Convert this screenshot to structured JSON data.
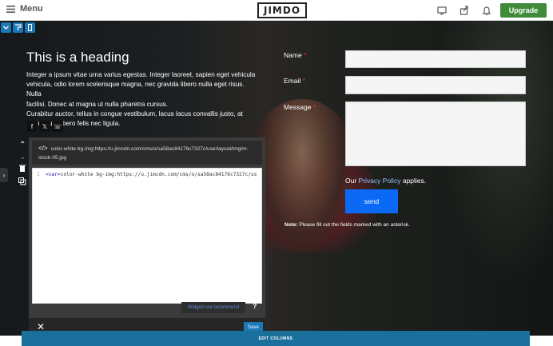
{
  "topbar": {
    "menu_label": "Menu",
    "logo": "JIMDO",
    "upgrade_label": "Upgrade",
    "icons": [
      "desktop-preview-icon",
      "share-icon",
      "bell-icon"
    ]
  },
  "content": {
    "heading": "This is a heading",
    "paragraph_lines": [
      "Integer a ipsum vitae urna varius egestas. Integer laoreet, sapien eget vehicula",
      "vehicula, odio lorem scelerisque magna, nec gravida libero nulla eget risus. Nulla",
      "facilisi. Donec at magna ut nulla pharetra cursus.",
      "Curabitur auctor, tellus in congue vestibulum, lacus lacus convallis justo, at",
      "fermentum libero felis nec ligula."
    ],
    "social": [
      "f",
      "𝕏",
      "☏"
    ]
  },
  "form": {
    "name_label": "Name",
    "email_label": "Email",
    "message_label": "Message",
    "required_mark": "*",
    "policy_prefix": "Our",
    "policy_link": "Privacy Policy",
    "policy_suffix": "applies.",
    "send_label": "send",
    "note_bold": "Note:",
    "note_text": "Please fill out the fields marked with an asterisk."
  },
  "editor": {
    "path_line1": "color-white bg-img:https://u.jimcdn.com/cms/o/sa58ac84176c7327c/userlayout/img/m-",
    "path_line2": "stock-05.jpg",
    "line_number": "1",
    "code_tag": "<var>",
    "code_text": "color-white bg-img:https://u.jimcdn.com/cms/o/sa58ac84176c7327c/us",
    "widgets_label": "Widgets we recommend",
    "help_label": "?",
    "save_label": "Save"
  },
  "edit_columns_label": "EDIT COLUMNS",
  "colors": {
    "upgrade_green": "#3f8b3a",
    "send_blue": "#0a6af5",
    "editor_blue": "#1b79b7",
    "required_red": "#e33"
  }
}
